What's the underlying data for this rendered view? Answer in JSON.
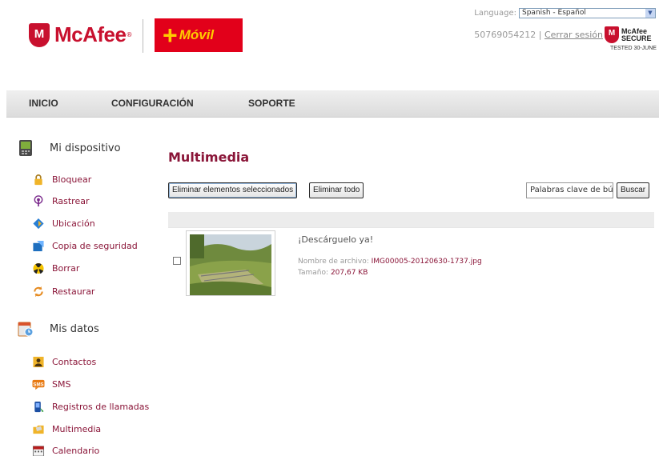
{
  "header": {
    "mcafee_brand": "McAfee",
    "partner_brand": "Móvil",
    "language_label": "Language:",
    "language_value": "Spanish - Español",
    "phone_number": "50769054212",
    "separator": "|",
    "logout_label": "Cerrar sesión",
    "secure_badge": {
      "line1": "McAfee",
      "line2": "SECURE",
      "line3": "TESTED 30-JUNE"
    }
  },
  "nav": {
    "items": [
      "INICIO",
      "CONFIGURACIÓN",
      "SOPORTE"
    ]
  },
  "sidebar": {
    "device_section": {
      "title": "Mi dispositivo",
      "items": [
        "Bloquear",
        "Rastrear",
        "Ubicación",
        "Copia de seguridad",
        "Borrar",
        "Restaurar"
      ]
    },
    "data_section": {
      "title": "Mis datos",
      "items": [
        "Contactos",
        "SMS",
        "Registros de llamadas",
        "Multimedia",
        "Calendario"
      ]
    },
    "sms_badge": "SMS"
  },
  "main": {
    "title": "Multimedia",
    "delete_selected_label": "Eliminar elementos seleccionados",
    "delete_all_label": "Eliminar todo",
    "search_value": "Palabras clave de bú",
    "search_button_label": "Buscar",
    "rows": [
      {
        "title": "¡Descárguelo ya!",
        "filename_label": "Nombre de archivo:",
        "filename_value": "IMG00005-20120630-1737.jpg",
        "size_label": "Tamaño:",
        "size_value": "207,67 KB"
      }
    ]
  },
  "colors": {
    "brand_red": "#c8102e",
    "partner_red": "#e2001a",
    "accent_text": "#8a1538",
    "nav_bg": "#e6e6e6"
  }
}
